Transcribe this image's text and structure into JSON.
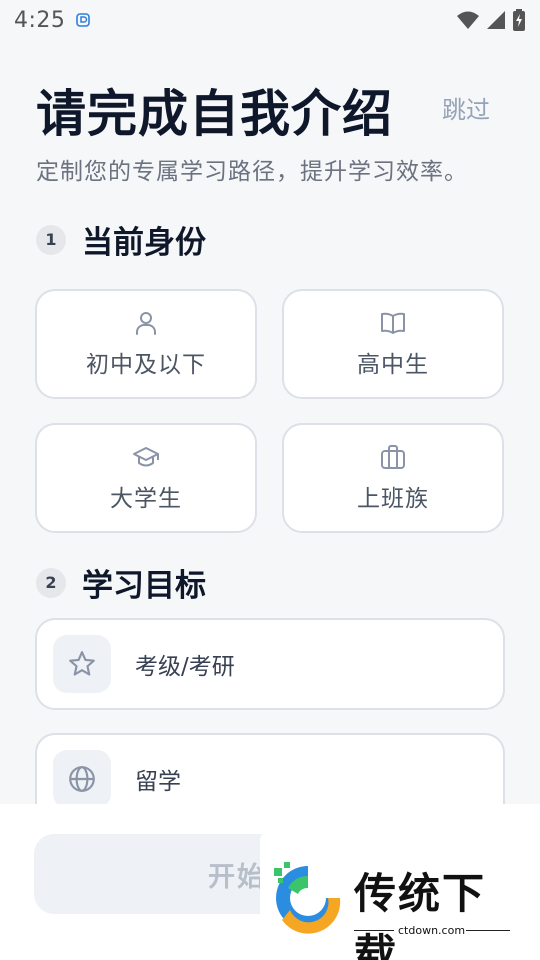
{
  "status_bar": {
    "time": "4:25"
  },
  "header": {
    "title": "请完成自我介绍",
    "skip_label": "跳过",
    "subtitle": "定制您的专属学习路径，提升学习效率。"
  },
  "sections": [
    {
      "step": "1",
      "title": "当前身份"
    },
    {
      "step": "2",
      "title": "学习目标"
    }
  ],
  "identity_options": [
    {
      "label": "初中及以下",
      "icon": "user-icon"
    },
    {
      "label": "高中生",
      "icon": "book-icon"
    },
    {
      "label": "大学生",
      "icon": "graduation-cap-icon"
    },
    {
      "label": "上班族",
      "icon": "briefcase-icon"
    }
  ],
  "goal_options": [
    {
      "label": "考级/考研",
      "icon": "star-icon"
    },
    {
      "label": "留学",
      "icon": "globe-icon"
    }
  ],
  "footer": {
    "start_label": "开始"
  },
  "watermark": {
    "brand": "传统下载",
    "domain": "ctdown.com"
  },
  "colors": {
    "icon": "#8a94a6",
    "title": "#0f172a",
    "border": "#dde1e7"
  }
}
